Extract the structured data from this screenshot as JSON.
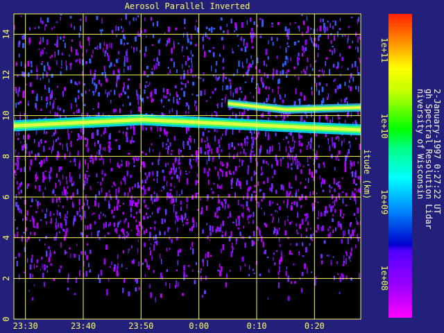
{
  "chart_data": {
    "type": "heatmap",
    "title": "Aerosol Parallel Inverted",
    "xlabel": "",
    "ylabel": "itude (km)",
    "x_ticks": [
      "23:30",
      "23:40",
      "23:50",
      "0:00",
      "0:10",
      "0:20"
    ],
    "x_range_minutes": [
      -32,
      28
    ],
    "ylim": [
      0,
      15
    ],
    "y_ticks": [
      0,
      2,
      4,
      6,
      8,
      10,
      12,
      14
    ],
    "grid": true,
    "colorbar": {
      "scale": "log",
      "range": [
        30000000.0,
        300000000000.0
      ],
      "tick_labels": [
        "1e+08",
        "1e+09",
        "1e+10",
        "1e+11"
      ],
      "tick_values": [
        100000000.0,
        1000000000.0,
        10000000000.0,
        100000000000.0
      ],
      "colors": [
        "#ff00ff",
        "#8000ff",
        "#0000ff",
        "#00c0ff",
        "#00ff80",
        "#00ff00",
        "#ffff00",
        "#ff8000",
        "#ff0000"
      ]
    },
    "features": [
      {
        "name": "main_layer",
        "altitude_km": [
          9.5,
          9.8,
          9.6,
          9.3
        ],
        "time_minutes": [
          -32,
          -10,
          5,
          28
        ]
      },
      {
        "name": "upper_layer",
        "altitude_km": [
          10.6,
          10.3,
          10.4
        ],
        "time_minutes": [
          5,
          15,
          28
        ]
      }
    ]
  },
  "credits": {
    "line1": "niversity of Wisconsin",
    "line2": "gh Spectral Resolution Lidar",
    "line3": "2-January-1997  0:27:22 UT"
  }
}
